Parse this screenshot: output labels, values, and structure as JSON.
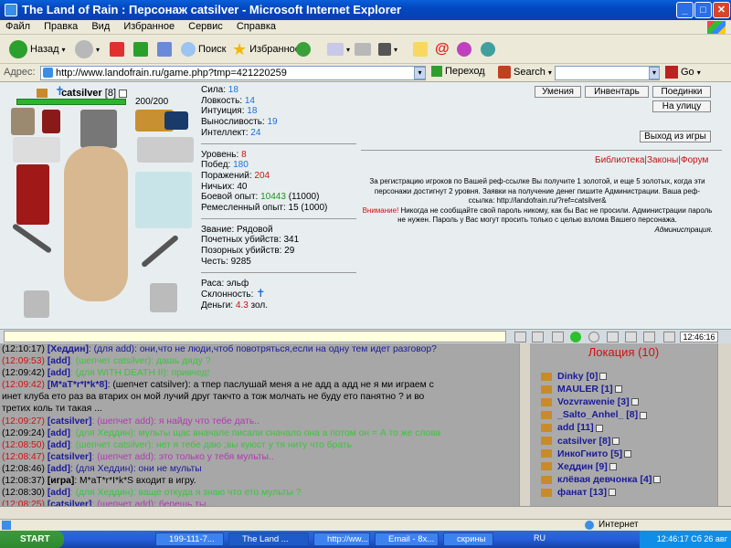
{
  "window": {
    "title": "The Land of Rain : Персонаж catsilver - Microsoft Internet Explorer"
  },
  "menu": [
    "Файл",
    "Правка",
    "Вид",
    "Избранное",
    "Сервис",
    "Справка"
  ],
  "toolbar": {
    "back": "Назад",
    "search": "Поиск",
    "favorites": "Избранное"
  },
  "address": {
    "label": "Адрес:",
    "url": "http://www.landofrain.ru/game.php?tmp=421220259",
    "go": "Переход",
    "search_label": "Search",
    "go2": "Go"
  },
  "character": {
    "name": "catsilver",
    "level": "[8]",
    "hp": "200/200",
    "hp_fraction": 1.0,
    "stats": [
      {
        "label": "Сила:",
        "value": "18"
      },
      {
        "label": "Ловкость:",
        "value": "14"
      },
      {
        "label": "Интуиция:",
        "value": "18"
      },
      {
        "label": "Выносливость:",
        "value": "19"
      },
      {
        "label": "Интеллект:",
        "value": "24"
      }
    ],
    "level_line": {
      "label": "Уровень:",
      "value": "8"
    },
    "wins": {
      "label": "Побед:",
      "value": "180"
    },
    "losses": {
      "label": "Поражений:",
      "value": "204"
    },
    "draws": "Ничьих: 40",
    "combat_xp": {
      "label": "Боевой опыт:",
      "value": "10443",
      "extra": "(11000)"
    },
    "craft_xp": "Ремесленный опыт: 15 (1000)",
    "rank": "Звание: Рядовой",
    "honor_kills": "Почетных убийств: 341",
    "shame_kills": "Позорных убийств: 29",
    "honor": "Честь: 9285",
    "race": "Раса: эльф",
    "alignment": "Склонность:",
    "money": {
      "label": "Деньги:",
      "value": "4.3",
      "unit": "зол."
    }
  },
  "buttons": {
    "skills": "Умения",
    "inventory": "Инвентарь",
    "fights": "Поединки",
    "street": "На улицу",
    "exit": "Выход из игры"
  },
  "links": {
    "library": "Библиотека",
    "laws": "Законы",
    "forum": "Форум",
    "sep": "|"
  },
  "info": {
    "referral": "За регистрацию игроков по Вашей реф-ссылке Вы получите 1 золотой, и еще 5 золотых, когда эти персонажи достигнут 2 уровня. Заявки на получение денег пишите Администрации. Ваша реф-ссылка: http://landofrain.ru/?ref=catsilver&",
    "warning_label": "Внимание!",
    "warning": "Никогда не сообщайте свой пароль никому, как бы Вас не просили. Администрации пароль не нужен. Пароль у Вас могут просить только с целью взлома Вашего персонажа.",
    "signature": "Администрация."
  },
  "clock": "12:46:16",
  "chat": [
    {
      "time": "(12:10:17)",
      "tc": "#000",
      "who": "[Хеддин]",
      "wc": "#1a1a9a",
      "msg": ": (для add): они,что не люди,чтоб повотряться,если на одну тем идет разговор?",
      "mc": "#1a1a9a"
    },
    {
      "time": "(12:09:53)",
      "tc": "#d01010",
      "who": "[add]",
      "wc": "#1a1a9a",
      "msg": ": (шепчет catsilver): дашь дяду ?",
      "mc": "#3cc43c"
    },
    {
      "time": "(12:09:42)",
      "tc": "#000",
      "who": "[add]",
      "wc": "#1a1a9a",
      "msg": ": (для WITH DEATH II): привчед!",
      "mc": "#3cc43c"
    },
    {
      "time": "(12:09:42)",
      "tc": "#d01010",
      "who": "[M*aT*r*I*k*8]",
      "wc": "#1a1a9a",
      "msg": ": (шепчет catsilver): а тпер паслушай меня а не адд а адд не я ми играем с",
      "mc": "#000"
    },
    {
      "time": "",
      "tc": "#000",
      "who": "",
      "wc": "#000",
      "msg": "инет клуба ето раз ва втарих он мой лучий друг такчто а тож молчать не буду ето панятно ? и во",
      "mc": "#000"
    },
    {
      "time": "",
      "tc": "#000",
      "who": "",
      "wc": "#000",
      "msg": "третих коль ти такая ...",
      "mc": "#000"
    },
    {
      "time": "(12:09:27)",
      "tc": "#d01010",
      "who": "[catsilver]",
      "wc": "#1a1a9a",
      "msg": ": (шепчет add): я найду что тебе дать..",
      "mc": "#b03ab0"
    },
    {
      "time": "(12:09:24)",
      "tc": "#000",
      "who": "[add]",
      "wc": "#1a1a9a",
      "msg": ": (для Хеддин): мульты щас вначале писали сначало она а потом он = А то же слова",
      "mc": "#3cc43c"
    },
    {
      "time": "(12:08:50)",
      "tc": "#d01010",
      "who": "[add]",
      "wc": "#1a1a9a",
      "msg": ": (шепчет catsilver): нет я тебе даю ;вы куюст у тя ниту что брать",
      "mc": "#3cc43c"
    },
    {
      "time": "(12:08:47)",
      "tc": "#d01010",
      "who": "[catsilver]",
      "wc": "#1a1a9a",
      "msg": ": (шепчет add): это только у тебя мульты..",
      "mc": "#b03ab0"
    },
    {
      "time": "(12:08:46)",
      "tc": "#000",
      "who": "[add]",
      "wc": "#1a1a9a",
      "msg": ": (для Хеддин): они не мульты",
      "mc": "#1a1a9a"
    },
    {
      "time": "(12:08:37)",
      "tc": "#000",
      "who": "[игра]",
      "wc": "#000",
      "msg": ": M*aT*r*I*k*S входит в игру.",
      "mc": "#000"
    },
    {
      "time": "(12:08:30)",
      "tc": "#000",
      "who": "[add]",
      "wc": "#1a1a9a",
      "msg": ": (для Хеддин): ваще откуда я знаю что ето мульты ?",
      "mc": "#3cc43c"
    },
    {
      "time": "(12:08:25)",
      "tc": "#d01010",
      "who": "[catsilver]",
      "wc": "#1a1a9a",
      "msg": ": (шепчет add): берешь ты..",
      "mc": "#b03ab0"
    }
  ],
  "location": {
    "title": "Локация (10)"
  },
  "users": [
    {
      "name": "Dinky",
      "lvl": "[0]"
    },
    {
      "name": "MAULER",
      "lvl": "[1]"
    },
    {
      "name": "Vozvrawenie",
      "lvl": "[3]"
    },
    {
      "name": "_Salto_Anhel_",
      "lvl": "[8]"
    },
    {
      "name": "add",
      "lvl": "[11]"
    },
    {
      "name": "catsilver",
      "lvl": "[8]"
    },
    {
      "name": "ИнкоГнито",
      "lvl": "[5]"
    },
    {
      "name": "Хеддин",
      "lvl": "[9]"
    },
    {
      "name": "клёвая девчонка",
      "lvl": "[4]"
    },
    {
      "name": "фанат",
      "lvl": "[13]"
    }
  ],
  "status": {
    "zone": "Интернет"
  },
  "taskbar": {
    "start": "START",
    "tasks": [
      "199-111-7...",
      "The Land ...",
      "http://ww...",
      "Email - 8x...",
      "скрины"
    ],
    "lang": "RU",
    "time": "12:46:17 Сб 26 авг"
  }
}
